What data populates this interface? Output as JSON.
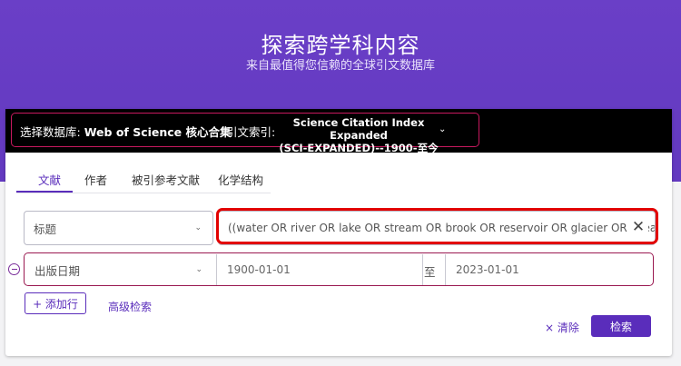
{
  "hero": {
    "title": "探索跨学科内容",
    "subtitle": "来自最值得您信赖的全球引文数据库"
  },
  "database_bar": {
    "db_label": "选择数据库:",
    "db_value": "Web of Science 核心合集",
    "index_label": "引文索引:",
    "index_value_line1": "Science Citation Index Expanded",
    "index_value_line2": "(SCI-EXPANDED)--1900-至今"
  },
  "tabs": [
    {
      "label": "文献",
      "active": true
    },
    {
      "label": "作者",
      "active": false
    },
    {
      "label": "被引参考文献",
      "active": false
    },
    {
      "label": "化学结构",
      "active": false
    }
  ],
  "rows": [
    {
      "field": "标题",
      "value": "((water OR river OR lake OR stream OR brook OR reservoir OR glacier OR ocean OR sea OR"
    },
    {
      "field": "出版日期",
      "date_from": "1900-01-01",
      "to_label": "至",
      "date_to": "2023-01-01"
    }
  ],
  "actions": {
    "add_row": "+ 添加行",
    "advanced": "高级检索",
    "clear": "× 清除",
    "search": "检索"
  },
  "icons": {
    "caret": "chevron-down-icon",
    "clear_field": "close-icon",
    "remove_row": "minus-circle-icon"
  },
  "colors": {
    "brand_purple": "#5a2dbb",
    "highlight_red": "#e20000",
    "bar_black": "#000000"
  }
}
